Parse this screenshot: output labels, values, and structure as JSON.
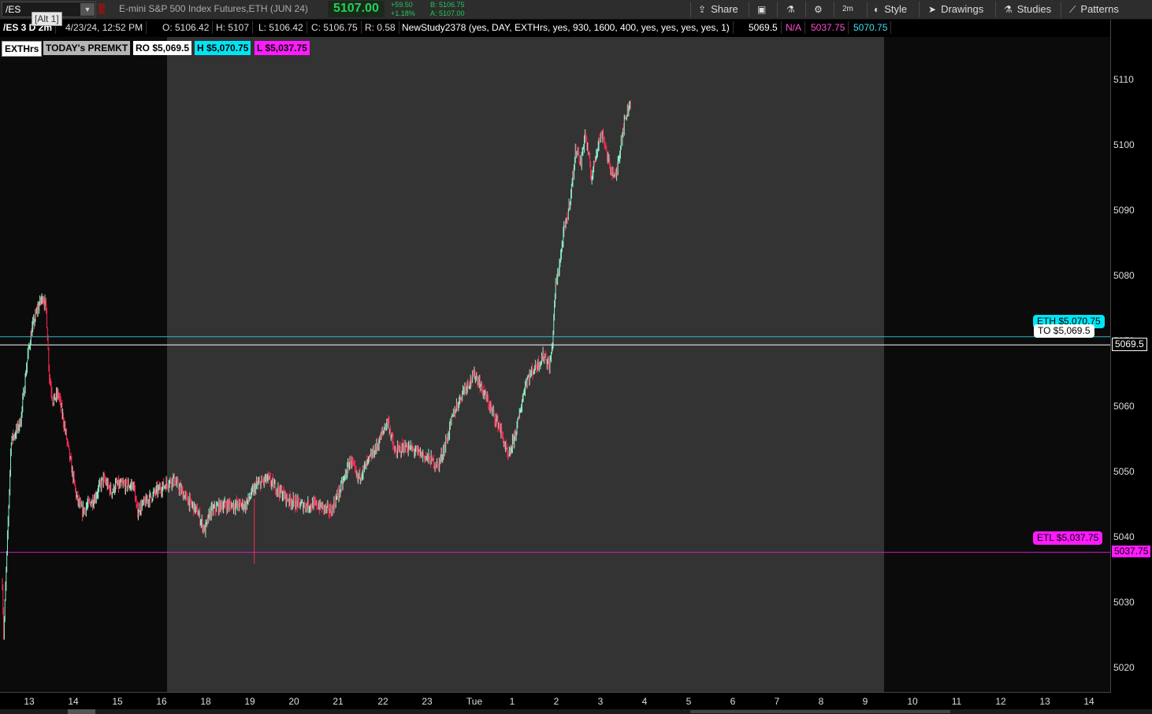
{
  "toolbar": {
    "symbol": "/ES",
    "alt_tooltip": "[Alt 1]",
    "instrument": "E-mini S&P 500 Index Futures,ETH (JUN 24)",
    "last_price": "5107.00",
    "change_abs": "+59.50",
    "change_pct": "+1.18%",
    "bid": "B: 5106.75",
    "ask": "A: 5107.00",
    "share_label": "Share",
    "timeframe_label": "2m",
    "style_label": "Style",
    "drawings_label": "Drawings",
    "studies_label": "Studies",
    "patterns_label": "Patterns"
  },
  "studybar": {
    "chart_name": "/ES 3 D 2m",
    "timestamp": "4/23/24, 12:52 PM",
    "open": "O: 5106.42",
    "high": "H: 5107",
    "low": "L: 5106.42",
    "close": "C: 5106.75",
    "range": "R: 0.58",
    "study": "NewStudy2378 (yes, DAY, EXTHrs, yes, 930, 1600, 400, yes, yes, yes, yes, 1)",
    "value1": "5069.5",
    "value2": "N/A",
    "value3": "5037.75",
    "value4": "5070.75"
  },
  "labels": {
    "exthrs": "EXTHrs",
    "premkt": "TODAY's PREMKT",
    "ro": "RO $5,069.5",
    "high": "H $5,070.75",
    "low": "L $5,037.75"
  },
  "callouts": {
    "eth": "ETH $5,070.75",
    "to": "TO $5,069.5",
    "etl": "ETL $5,037.75"
  },
  "axis_tags": {
    "open_tag": "5069.5",
    "low_tag": "5037.75"
  },
  "price_axis": {
    "ticks": [
      "5110",
      "5100",
      "5090",
      "5080",
      "5070",
      "5060",
      "5050",
      "5040",
      "5030",
      "5020"
    ]
  },
  "date_axis": {
    "ticks": [
      "13",
      "14",
      "15",
      "16",
      "18",
      "19",
      "20",
      "21",
      "22",
      "23",
      "Tue",
      "1",
      "2",
      "3",
      "4",
      "5",
      "6",
      "7",
      "8",
      "9",
      "10",
      "11",
      "12",
      "13",
      "14"
    ]
  },
  "colors": {
    "up": "#8ef0c8",
    "down": "#ff2a55",
    "cyan": "#00e0f0",
    "magenta": "#ff1aff",
    "session_bg": "#333333"
  },
  "chart_data": {
    "type": "candlestick",
    "price_min": 5020,
    "price_max": 5110,
    "levels": {
      "to": 5069.5,
      "eth": 5070.75,
      "etl": 5037.75
    },
    "keypoints": [
      [
        0,
        5033
      ],
      [
        0.03,
        5025
      ],
      [
        0.14,
        5044
      ],
      [
        0.2,
        5055
      ],
      [
        0.3,
        5056
      ],
      [
        0.42,
        5058
      ],
      [
        0.58,
        5068
      ],
      [
        0.68,
        5072
      ],
      [
        0.8,
        5075
      ],
      [
        0.92,
        5077
      ],
      [
        1.0,
        5075
      ],
      [
        1.07,
        5065
      ],
      [
        1.15,
        5061
      ],
      [
        1.28,
        5062
      ],
      [
        1.42,
        5057
      ],
      [
        1.57,
        5051
      ],
      [
        1.7,
        5046
      ],
      [
        1.82,
        5044
      ],
      [
        1.95,
        5045
      ],
      [
        2.1,
        5046
      ],
      [
        2.3,
        5049
      ],
      [
        2.5,
        5047
      ],
      [
        2.58,
        5048
      ],
      [
        3.0,
        5048
      ],
      [
        3.07,
        5044
      ],
      [
        3.2,
        5045
      ],
      [
        3.5,
        5047
      ],
      [
        3.9,
        5049
      ],
      [
        4.2,
        5046
      ],
      [
        4.45,
        5044
      ],
      [
        4.62,
        5041
      ],
      [
        4.75,
        5044
      ],
      [
        5.0,
        5045
      ],
      [
        5.3,
        5045
      ],
      [
        5.55,
        5045
      ],
      [
        5.8,
        5048
      ],
      [
        6.05,
        5049
      ],
      [
        6.2,
        5048
      ],
      [
        6.5,
        5046
      ],
      [
        6.8,
        5045
      ],
      [
        7.2,
        5045
      ],
      [
        7.5,
        5044
      ],
      [
        7.75,
        5048
      ],
      [
        7.95,
        5052
      ],
      [
        8.1,
        5049
      ],
      [
        8.3,
        5051
      ],
      [
        8.55,
        5054
      ],
      [
        8.8,
        5058
      ],
      [
        8.95,
        5053
      ],
      [
        9.2,
        5054
      ],
      [
        9.5,
        5053
      ],
      [
        9.75,
        5052
      ],
      [
        9.95,
        5051
      ],
      [
        10.1,
        5054
      ],
      [
        10.3,
        5059
      ],
      [
        10.55,
        5063
      ],
      [
        10.8,
        5065
      ],
      [
        11.0,
        5062
      ],
      [
        11.2,
        5059
      ],
      [
        11.35,
        5057
      ],
      [
        11.55,
        5052
      ],
      [
        11.75,
        5057
      ],
      [
        11.95,
        5064
      ],
      [
        12.15,
        5066
      ],
      [
        12.38,
        5068
      ],
      [
        12.48,
        5066
      ],
      [
        12.55,
        5069
      ],
      [
        12.62,
        5078
      ],
      [
        12.72,
        5082
      ],
      [
        12.82,
        5087
      ],
      [
        12.9,
        5089
      ],
      [
        13.0,
        5094
      ],
      [
        13.1,
        5100
      ],
      [
        13.2,
        5097
      ],
      [
        13.3,
        5102
      ],
      [
        13.45,
        5095
      ],
      [
        13.58,
        5100
      ],
      [
        13.7,
        5102
      ],
      [
        13.85,
        5097
      ],
      [
        14.0,
        5095
      ],
      [
        14.15,
        5102
      ],
      [
        14.25,
        5105
      ],
      [
        14.35,
        5107
      ]
    ]
  }
}
